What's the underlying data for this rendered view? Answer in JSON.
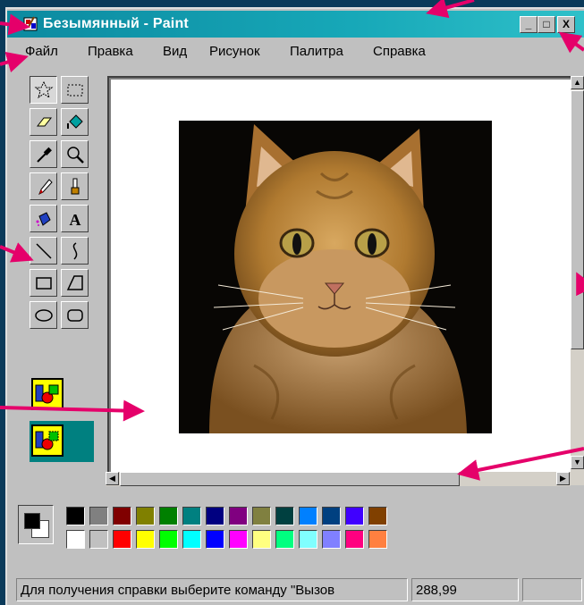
{
  "window": {
    "title": "Безымянный - Paint",
    "buttons": {
      "minimize": "_",
      "maximize": "□",
      "close": "X"
    }
  },
  "menu": [
    "Файл",
    "Правка",
    "Вид",
    "Рисунок",
    "Палитра",
    "Справка"
  ],
  "toolbox": {
    "tools": [
      "free-select-icon",
      "rect-select-icon",
      "eraser-icon",
      "fill-icon",
      "pick-color-icon",
      "magnifier-icon",
      "pencil-icon",
      "brush-icon",
      "airbrush-icon",
      "text-icon",
      "line-icon",
      "curve-icon",
      "rectangle-icon",
      "polygon-icon",
      "ellipse-icon",
      "rounded-rect-icon"
    ],
    "options": [
      "opaque-option-icon",
      "transparent-option-icon"
    ]
  },
  "canvas": {
    "image": "cat-photo",
    "background": "#ffffff"
  },
  "palette": {
    "foreground": "#000000",
    "background": "#ffffff",
    "row1": [
      "#000000",
      "#808080",
      "#800000",
      "#808000",
      "#008000",
      "#008080",
      "#000080",
      "#800080",
      "#808040",
      "#004040",
      "#0080ff",
      "#004080",
      "#4000ff",
      "#804000"
    ],
    "row2": [
      "#ffffff",
      "#c0c0c0",
      "#ff0000",
      "#ffff00",
      "#00ff00",
      "#00ffff",
      "#0000ff",
      "#ff00ff",
      "#ffff80",
      "#00ff80",
      "#80ffff",
      "#8080ff",
      "#ff0080",
      "#ff8040"
    ]
  },
  "status": {
    "help_text": "Для получения справки выберите команду \"Вызов",
    "coords": "288,99"
  },
  "accent_colors": {
    "titlebar": "#17a8b8",
    "arrows": "#e5006a"
  }
}
